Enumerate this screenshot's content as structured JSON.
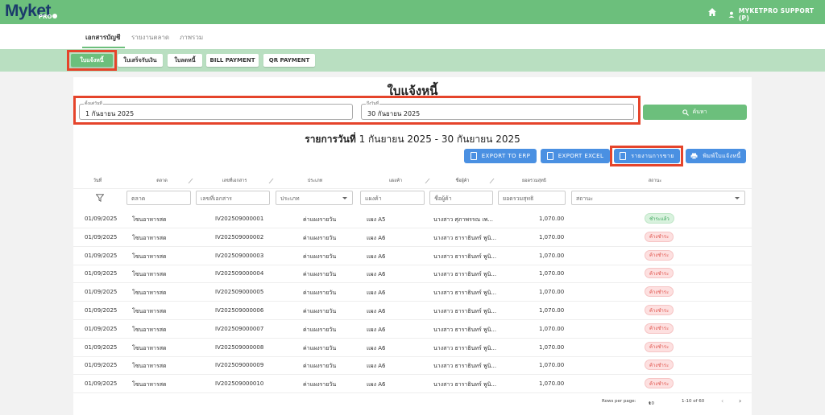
{
  "app": {
    "logo": "Myket",
    "logo_sub": "PRO",
    "user": "MYKETPRO SUPPORT (P)"
  },
  "subnav": {
    "tabs": [
      "เอกสารบัญชี",
      "รายงานตลาด",
      "ภาพรวม"
    ]
  },
  "doc_tabs": [
    "ใบแจ้งหนี้",
    "ใบเสร็จรับเงิน",
    "ใบลดหนี้",
    "BILL PAYMENT",
    "QR PAYMENT"
  ],
  "page": {
    "title": "ใบแจ้งหนี้",
    "from_label": "ตั้งแต่วันที่",
    "from_value": "1 กันยายน 2025",
    "to_label": "ถึงวันที่",
    "to_value": "30 กันยายน 2025",
    "search_label": "ค้นหา",
    "subtitle_prefix": "รายการวันที่",
    "subtitle_range": "1 กันยายน 2025 - 30 กันยายน 2025"
  },
  "actions": {
    "export_erp": "EXPORT TO ERP",
    "export_excel": "EXPORT EXCEL",
    "sales_report": "รายงานการขาย",
    "print": "พิมพ์ใบแจ้งหนี้"
  },
  "table": {
    "headers": [
      "วันที่",
      "ตลาด",
      "เลขที่เอกสาร",
      "ประเภท",
      "แผงค้า",
      "ชื่อผู้ค้า",
      "ยอดรวมสุทธิ",
      "สถานะ"
    ],
    "filters": {
      "market": "ตลาด",
      "doc_no": "เลขที่เอกสาร",
      "type": "ประเภท",
      "stall": "แผงค้า",
      "merchant": "ชื่อผู้ค้า",
      "total": "ยอดรวมสุทธิ",
      "status": "สถานะ"
    },
    "rows": [
      {
        "date": "01/09/2025",
        "market": "โซนอาหารสด",
        "doc": "IV202509000001",
        "type": "ค่าแผงรายวัน",
        "stall": "แผง A5",
        "merchant": "นางสาว ศุภาพรรณ เพ...",
        "total": "1,070.00",
        "status": "ชำระแล้ว",
        "paid": true
      },
      {
        "date": "01/09/2025",
        "market": "โซนอาหารสด",
        "doc": "IV202509000002",
        "type": "ค่าแผงรายวัน",
        "stall": "แผง A6",
        "merchant": "นางสาว ธาราธินทร์ พูนิ...",
        "total": "1,070.00",
        "status": "ค้างชำระ",
        "paid": false
      },
      {
        "date": "01/09/2025",
        "market": "โซนอาหารสด",
        "doc": "IV202509000003",
        "type": "ค่าแผงรายวัน",
        "stall": "แผง A6",
        "merchant": "นางสาว ธาราธินทร์ พูนิ...",
        "total": "1,070.00",
        "status": "ค้างชำระ",
        "paid": false
      },
      {
        "date": "01/09/2025",
        "market": "โซนอาหารสด",
        "doc": "IV202509000004",
        "type": "ค่าแผงรายวัน",
        "stall": "แผง A6",
        "merchant": "นางสาว ธาราธินทร์ พูนิ...",
        "total": "1,070.00",
        "status": "ค้างชำระ",
        "paid": false
      },
      {
        "date": "01/09/2025",
        "market": "โซนอาหารสด",
        "doc": "IV202509000005",
        "type": "ค่าแผงรายวัน",
        "stall": "แผง A6",
        "merchant": "นางสาว ธาราธินทร์ พูนิ...",
        "total": "1,070.00",
        "status": "ค้างชำระ",
        "paid": false
      },
      {
        "date": "01/09/2025",
        "market": "โซนอาหารสด",
        "doc": "IV202509000006",
        "type": "ค่าแผงรายวัน",
        "stall": "แผง A6",
        "merchant": "นางสาว ธาราธินทร์ พูนิ...",
        "total": "1,070.00",
        "status": "ค้างชำระ",
        "paid": false
      },
      {
        "date": "01/09/2025",
        "market": "โซนอาหารสด",
        "doc": "IV202509000007",
        "type": "ค่าแผงรายวัน",
        "stall": "แผง A6",
        "merchant": "นางสาว ธาราธินทร์ พูนิ...",
        "total": "1,070.00",
        "status": "ค้างชำระ",
        "paid": false
      },
      {
        "date": "01/09/2025",
        "market": "โซนอาหารสด",
        "doc": "IV202509000008",
        "type": "ค่าแผงรายวัน",
        "stall": "แผง A6",
        "merchant": "นางสาว ธาราธินทร์ พูนิ...",
        "total": "1,070.00",
        "status": "ค้างชำระ",
        "paid": false
      },
      {
        "date": "01/09/2025",
        "market": "โซนอาหารสด",
        "doc": "IV202509000009",
        "type": "ค่าแผงรายวัน",
        "stall": "แผง A6",
        "merchant": "นางสาว ธาราธินทร์ พูนิ...",
        "total": "1,070.00",
        "status": "ค้างชำระ",
        "paid": false
      },
      {
        "date": "01/09/2025",
        "market": "โซนอาหารสด",
        "doc": "IV202509000010",
        "type": "ค่าแผงรายวัน",
        "stall": "แผง A6",
        "merchant": "นางสาว ธาราธินทร์ พูนิ...",
        "total": "1,070.00",
        "status": "ค้างชำระ",
        "paid": false
      }
    ]
  },
  "pagination": {
    "rows_label": "Rows per page:",
    "rows_value": "10",
    "range": "1-10 of 60"
  },
  "colors": {
    "brand_green": "#6cbf7c",
    "light_green": "#b9dfc1",
    "action_blue": "#4a90e2",
    "highlight_red": "#e5442b"
  }
}
